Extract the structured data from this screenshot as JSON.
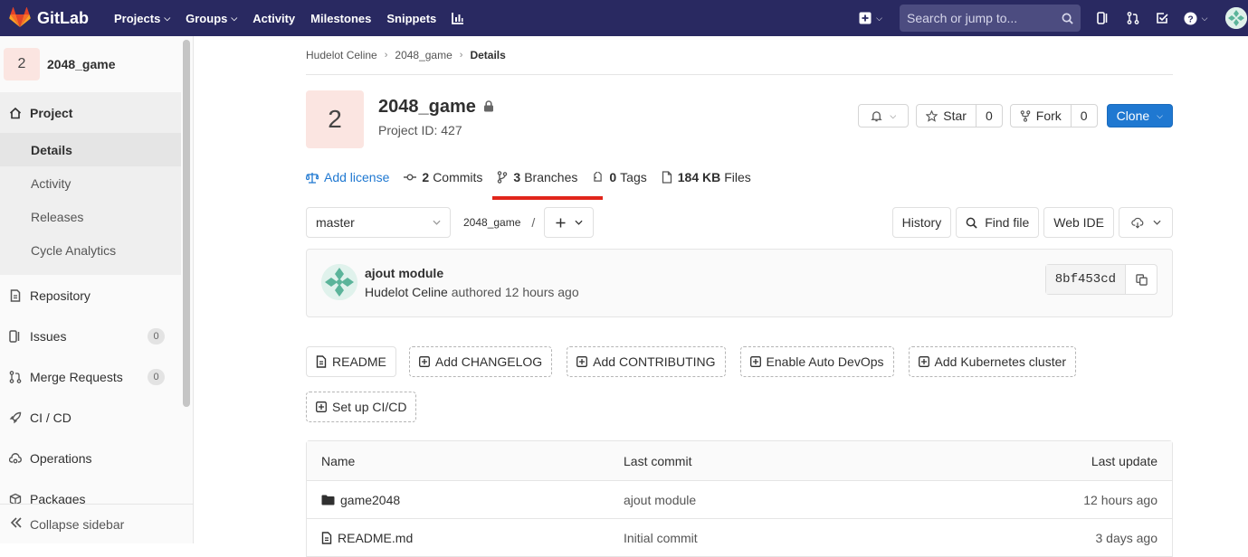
{
  "topnav": {
    "brand": "GitLab",
    "links": [
      {
        "label": "Projects",
        "dropdown": true
      },
      {
        "label": "Groups",
        "dropdown": true
      },
      {
        "label": "Activity",
        "dropdown": false
      },
      {
        "label": "Milestones",
        "dropdown": false
      },
      {
        "label": "Snippets",
        "dropdown": false
      }
    ],
    "search_placeholder": "Search or jump to..."
  },
  "sidebar": {
    "project_initial": "2",
    "project_name": "2048_game",
    "project_label": "Project",
    "project_subitems": [
      "Details",
      "Activity",
      "Releases",
      "Cycle Analytics"
    ],
    "items": [
      {
        "label": "Repository",
        "icon": "doc-icon"
      },
      {
        "label": "Issues",
        "icon": "issues-icon",
        "badge": "0"
      },
      {
        "label": "Merge Requests",
        "icon": "merge-request-icon",
        "badge": "0"
      },
      {
        "label": "CI / CD",
        "icon": "rocket-icon"
      },
      {
        "label": "Operations",
        "icon": "cloud-gear-icon"
      },
      {
        "label": "Packages",
        "icon": "package-icon"
      }
    ],
    "collapse_label": "Collapse sidebar"
  },
  "breadcrumb": {
    "owner": "Hudelot Celine",
    "project": "2048_game",
    "current": "Details"
  },
  "project": {
    "initial": "2",
    "title": "2048_game",
    "id_label": "Project ID: 427",
    "star_label": "Star",
    "star_count": "0",
    "fork_label": "Fork",
    "fork_count": "0",
    "clone_label": "Clone"
  },
  "stats": {
    "add_license": "Add license",
    "commits_count": "2",
    "commits_label": "Commits",
    "branches_count": "3",
    "branches_label": "Branches",
    "tags_count": "0",
    "tags_label": "Tags",
    "files_size": "184 KB",
    "files_label": "Files"
  },
  "toolbar": {
    "branch": "master",
    "path": "2048_game",
    "slash": "/",
    "history": "History",
    "find_file": "Find file",
    "web_ide": "Web IDE"
  },
  "commit": {
    "title": "ajout module",
    "author": "Hudelot Celine",
    "meta": "authored 12 hours ago",
    "sha": "8bf453cd"
  },
  "quick_buttons": [
    {
      "label": "README",
      "style": "solid"
    },
    {
      "label": "Add CHANGELOG",
      "style": "dashed"
    },
    {
      "label": "Add CONTRIBUTING",
      "style": "dashed"
    },
    {
      "label": "Enable Auto DevOps",
      "style": "dashed"
    },
    {
      "label": "Add Kubernetes cluster",
      "style": "dashed"
    },
    {
      "label": "Set up CI/CD",
      "style": "dashed"
    }
  ],
  "files": {
    "headers": {
      "name": "Name",
      "commit": "Last commit",
      "update": "Last update"
    },
    "rows": [
      {
        "name": "game2048",
        "type": "folder",
        "commit": "ajout module",
        "update": "12 hours ago"
      },
      {
        "name": "README.md",
        "type": "file",
        "commit": "Initial commit",
        "update": "3 days ago"
      }
    ]
  },
  "colors": {
    "navbar": "#292961",
    "accent_blue": "#1f78d1",
    "highlight_red": "#e1251b",
    "avatar_bg": "#fbe5e1"
  }
}
